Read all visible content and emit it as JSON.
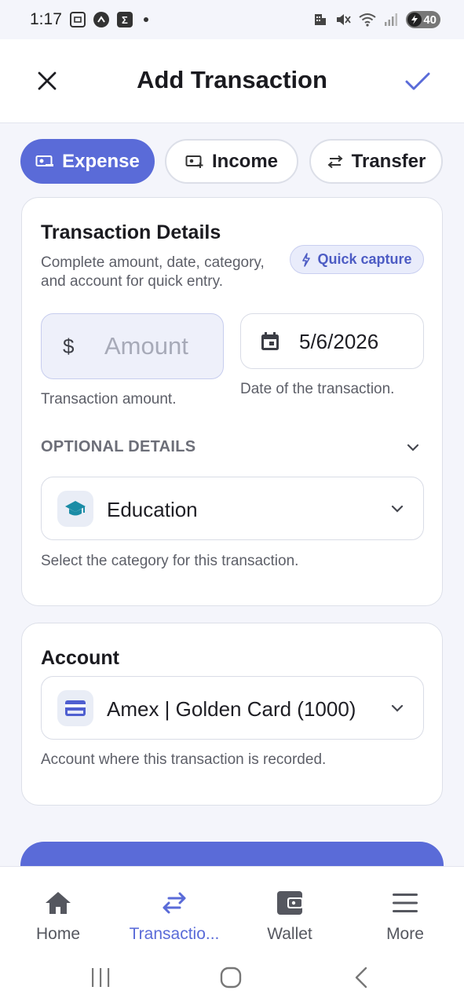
{
  "status_bar": {
    "time": "1:17",
    "battery": "40"
  },
  "header": {
    "title": "Add Transaction"
  },
  "type_toggle": [
    {
      "label": "Expense",
      "active": true
    },
    {
      "label": "Income",
      "active": false
    },
    {
      "label": "Transfer",
      "active": false
    }
  ],
  "details": {
    "title": "Transaction Details",
    "description": "Complete amount, date, category, and account for quick entry.",
    "quick_capture_label": "Quick capture",
    "amount": {
      "currency_symbol": "$",
      "placeholder": "Amount",
      "helper": "Transaction amount."
    },
    "date": {
      "value": "5/6/2026",
      "helper": "Date of the transaction."
    },
    "optional_label": "OPTIONAL DETAILS",
    "category": {
      "value": "Education",
      "helper": "Select the category for this transaction."
    }
  },
  "account": {
    "title": "Account",
    "value": "Amex | Golden Card (1000)",
    "helper": "Account where this transaction is recorded."
  },
  "bottom_nav": [
    {
      "label": "Home",
      "icon": "home-icon",
      "active": false
    },
    {
      "label": "Transactio...",
      "icon": "swap-icon",
      "active": true
    },
    {
      "label": "Wallet",
      "icon": "wallet-icon",
      "active": false
    },
    {
      "label": "More",
      "icon": "menu-icon",
      "active": false
    }
  ],
  "colors": {
    "accent": "#5a6bd8",
    "accent_soft": "#e9ecfb",
    "background": "#f4f5fb"
  }
}
